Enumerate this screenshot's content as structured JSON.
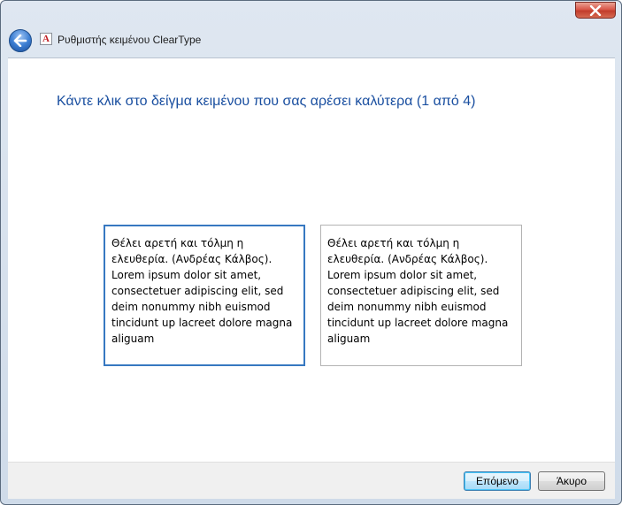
{
  "window": {
    "title": "Ρυθμιστής κειμένου ClearType"
  },
  "heading": "Κάντε κλικ στο δείγμα κειμένου που σας αρέσει καλύτερα (1 από 4)",
  "samples": [
    {
      "text": "Θέλει αρετή και τόλμη η ελευθερία. (Ανδρέας Κάλβος). Lorem ipsum dolor sit amet, consectetuer adipiscing elit, sed deim nonummy nibh euismod tincidunt up lacreet dolore magna aliguam",
      "selected": true
    },
    {
      "text": "Θέλει αρετή και τόλμη η ελευθερία. (Ανδρέας Κάλβος). Lorem ipsum dolor sit amet, consectetuer adipiscing elit, sed deim nonummy nibh euismod tincidunt up lacreet dolore magna aliguam",
      "selected": false
    }
  ],
  "buttons": {
    "next": "Επόμενο",
    "cancel": "Άκυρο"
  },
  "icons": {
    "back": "back-arrow-icon",
    "app": "cleartype-icon",
    "close": "close-icon"
  },
  "colors": {
    "heading": "#1a4fa0",
    "selected_border": "#3778c1",
    "close_button": "#c94634"
  }
}
